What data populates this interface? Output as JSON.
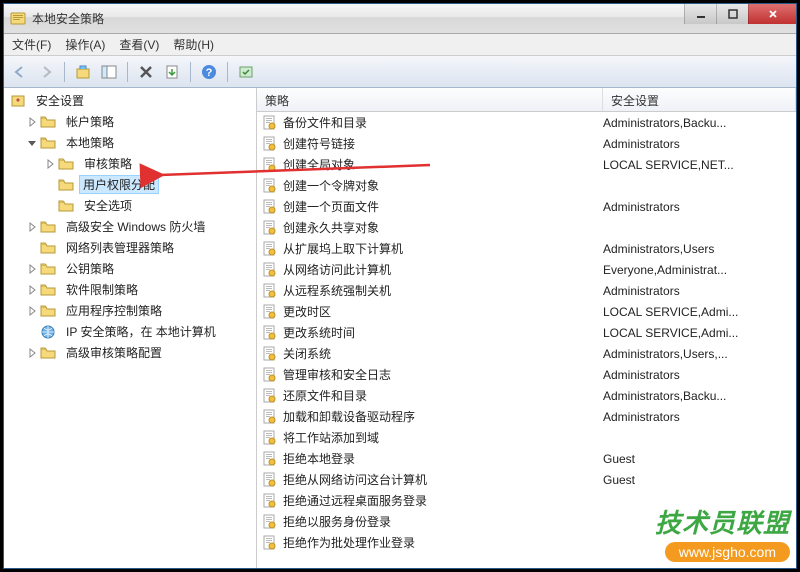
{
  "window": {
    "title": "本地安全策略"
  },
  "menu": {
    "file": "文件(F)",
    "action": "操作(A)",
    "view": "查看(V)",
    "help": "帮助(H)"
  },
  "tree_root": "安全设置",
  "tree_nodes": [
    {
      "label": "帐户策略",
      "indent": 1,
      "exp": "closed"
    },
    {
      "label": "本地策略",
      "indent": 1,
      "exp": "open"
    },
    {
      "label": "审核策略",
      "indent": 2,
      "exp": "closed"
    },
    {
      "label": "用户权限分配",
      "indent": 2,
      "exp": "none",
      "selected": true
    },
    {
      "label": "安全选项",
      "indent": 2,
      "exp": "none"
    },
    {
      "label": "高级安全 Windows 防火墙",
      "indent": 1,
      "exp": "closed"
    },
    {
      "label": "网络列表管理器策略",
      "indent": 1,
      "exp": "none"
    },
    {
      "label": "公钥策略",
      "indent": 1,
      "exp": "closed"
    },
    {
      "label": "软件限制策略",
      "indent": 1,
      "exp": "closed"
    },
    {
      "label": "应用程序控制策略",
      "indent": 1,
      "exp": "closed"
    },
    {
      "label": "IP 安全策略，在 本地计算机",
      "indent": 1,
      "exp": "none",
      "special": "ip"
    },
    {
      "label": "高级审核策略配置",
      "indent": 1,
      "exp": "closed"
    }
  ],
  "columns": {
    "policy": "策略",
    "setting": "安全设置"
  },
  "policies": [
    {
      "name": "备份文件和目录",
      "setting": "Administrators,Backu..."
    },
    {
      "name": "创建符号链接",
      "setting": "Administrators"
    },
    {
      "name": "创建全局对象",
      "setting": "LOCAL SERVICE,NET..."
    },
    {
      "name": "创建一个令牌对象",
      "setting": ""
    },
    {
      "name": "创建一个页面文件",
      "setting": "Administrators"
    },
    {
      "name": "创建永久共享对象",
      "setting": ""
    },
    {
      "name": "从扩展坞上取下计算机",
      "setting": "Administrators,Users"
    },
    {
      "name": "从网络访问此计算机",
      "setting": "Everyone,Administrat..."
    },
    {
      "name": "从远程系统强制关机",
      "setting": "Administrators"
    },
    {
      "name": "更改时区",
      "setting": "LOCAL SERVICE,Admi..."
    },
    {
      "name": "更改系统时间",
      "setting": "LOCAL SERVICE,Admi..."
    },
    {
      "name": "关闭系统",
      "setting": "Administrators,Users,..."
    },
    {
      "name": "管理审核和安全日志",
      "setting": "Administrators"
    },
    {
      "name": "还原文件和目录",
      "setting": "Administrators,Backu..."
    },
    {
      "name": "加载和卸载设备驱动程序",
      "setting": "Administrators"
    },
    {
      "name": "将工作站添加到域",
      "setting": ""
    },
    {
      "name": "拒绝本地登录",
      "setting": "Guest"
    },
    {
      "name": "拒绝从网络访问这台计算机",
      "setting": "Guest"
    },
    {
      "name": "拒绝通过远程桌面服务登录",
      "setting": ""
    },
    {
      "name": "拒绝以服务身份登录",
      "setting": ""
    },
    {
      "name": "拒绝作为批处理作业登录",
      "setting": ""
    }
  ],
  "watermark": {
    "text": "技术员联盟",
    "url": "www.jsgho.com"
  }
}
